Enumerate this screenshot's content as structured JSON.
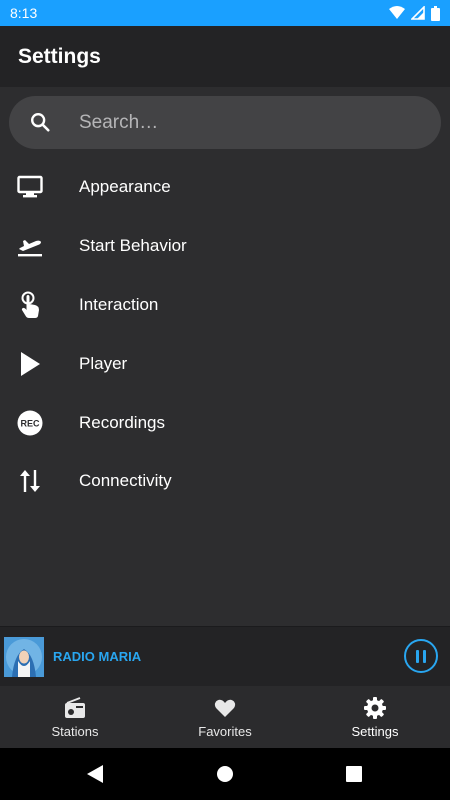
{
  "status_bar": {
    "time": "8:13",
    "bg_color": "#1aa0ff"
  },
  "app_bar": {
    "title": "Settings"
  },
  "search": {
    "placeholder": "Search…",
    "value": ""
  },
  "menu": {
    "items": [
      {
        "label": "Appearance",
        "icon": "monitor-icon"
      },
      {
        "label": "Start Behavior",
        "icon": "plane-takeoff-icon"
      },
      {
        "label": "Interaction",
        "icon": "touch-hand-icon"
      },
      {
        "label": "Player",
        "icon": "play-icon"
      },
      {
        "label": "Recordings",
        "icon": "rec-icon",
        "icon_text": "REC"
      },
      {
        "label": "Connectivity",
        "icon": "swap-vertical-icon"
      }
    ]
  },
  "mini_player": {
    "station": "RADIO MARIA",
    "state": "playing",
    "accent": "#29a6f0"
  },
  "bottom_nav": {
    "items": [
      {
        "label": "Stations",
        "icon": "radio-icon"
      },
      {
        "label": "Favorites",
        "icon": "heart-icon"
      },
      {
        "label": "Settings",
        "icon": "gear-icon"
      }
    ],
    "active": "Settings"
  }
}
